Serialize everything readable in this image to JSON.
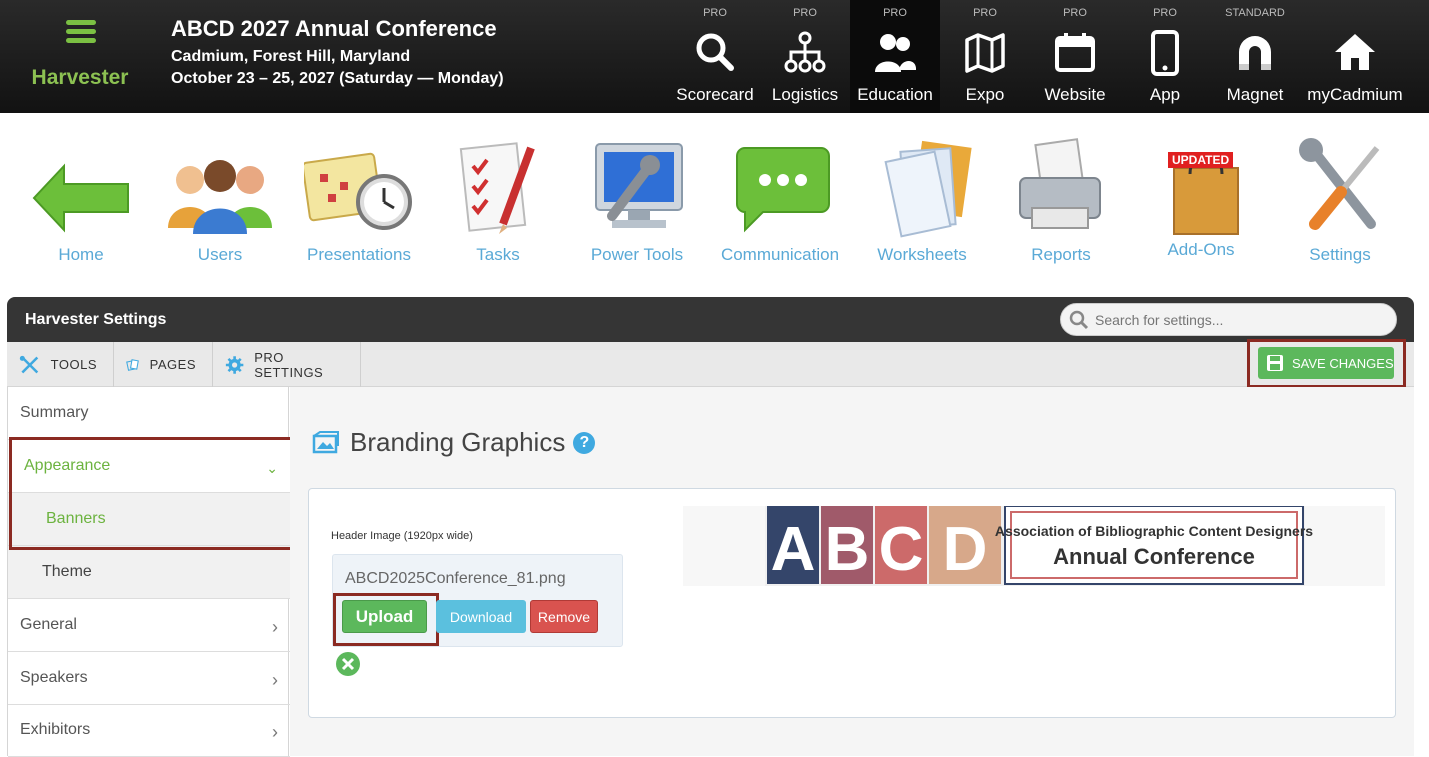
{
  "brand": {
    "name": "Harvester"
  },
  "conference": {
    "title": "ABCD 2027 Annual Conference",
    "location": "Cadmium, Forest Hill, Maryland",
    "dates": "October 23 – 25, 2027 (Saturday — Monday)"
  },
  "topnav": [
    {
      "tier": "PRO",
      "label": "Scorecard",
      "icon": "search-icon"
    },
    {
      "tier": "PRO",
      "label": "Logistics",
      "icon": "hierarchy-icon"
    },
    {
      "tier": "PRO",
      "label": "Education",
      "icon": "people-icon",
      "active": true
    },
    {
      "tier": "PRO",
      "label": "Expo",
      "icon": "map-icon"
    },
    {
      "tier": "PRO",
      "label": "Website",
      "icon": "calendar-icon"
    },
    {
      "tier": "PRO",
      "label": "App",
      "icon": "phone-icon"
    },
    {
      "tier": "STANDARD",
      "label": "Magnet",
      "icon": "magnet-icon"
    },
    {
      "tier": "",
      "label": "myCadmium",
      "icon": "home-icon"
    }
  ],
  "iconrow": [
    {
      "label": "Home",
      "icon": "back-arrow-icon"
    },
    {
      "label": "Users",
      "icon": "users-icon"
    },
    {
      "label": "Presentations",
      "icon": "calendar-clock-icon"
    },
    {
      "label": "Tasks",
      "icon": "checklist-icon"
    },
    {
      "label": "Power Tools",
      "icon": "monitor-wrench-icon"
    },
    {
      "label": "Communication",
      "icon": "chat-bubble-icon"
    },
    {
      "label": "Worksheets",
      "icon": "documents-icon"
    },
    {
      "label": "Reports",
      "icon": "printer-icon"
    },
    {
      "label": "Add-Ons",
      "icon": "shopping-bag-icon",
      "badge": "UPDATED"
    },
    {
      "label": "Settings",
      "icon": "tools-icon"
    }
  ],
  "panel": {
    "title": "Harvester Settings",
    "search_placeholder": "Search for settings...",
    "tabs": [
      "TOOLS",
      "PAGES",
      "PRO SETTINGS"
    ],
    "save_label": "SAVE CHANGES"
  },
  "sidebar": {
    "summary": "Summary",
    "appearance": "Appearance",
    "banners": "Banners",
    "theme": "Theme",
    "general": "General",
    "speakers": "Speakers",
    "exhibitors": "Exhibitors"
  },
  "content": {
    "title": "Branding Graphics",
    "help": "?",
    "field_label": "Header Image (1920px wide)",
    "file_name": "ABCD2025Conference_81.png",
    "upload": "Upload",
    "download": "Download",
    "remove": "Remove"
  },
  "banner": {
    "letters": [
      "A",
      "B",
      "C",
      "D"
    ],
    "org_name": "Association of Bibliographic Content Designers",
    "event": "Annual Conference"
  },
  "colors": {
    "accent_green": "#5cb85c",
    "link_blue": "#5aa9d6",
    "highlight_red": "#8b2a22",
    "banner_a": "#34456a",
    "banner_b": "#a05a6a",
    "banner_c": "#cc6a6a",
    "banner_d": "#d7a88a"
  }
}
